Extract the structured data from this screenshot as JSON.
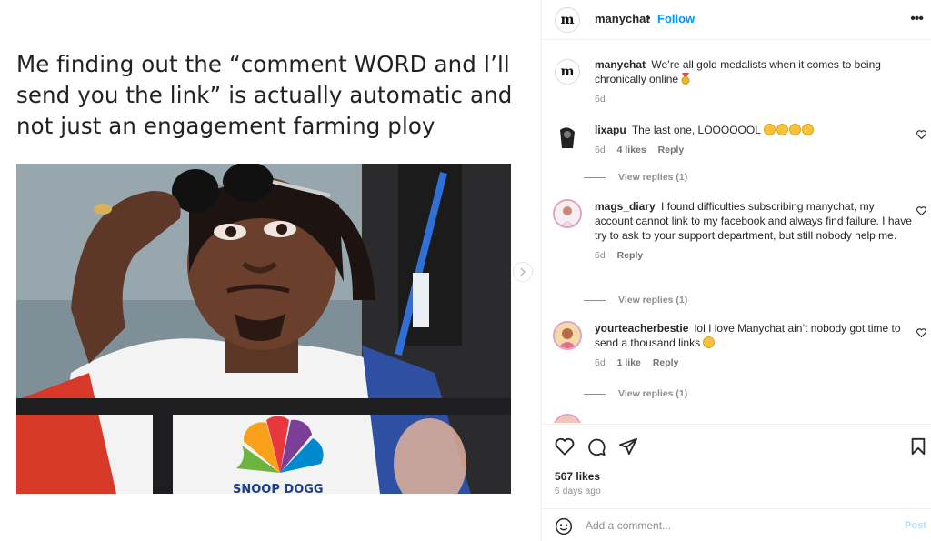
{
  "post": {
    "caption_image_text": "Me finding out the “comment WORD and I’ll send you the link” is actually automatic and not just an engagement farming ploy",
    "photo_alt": "Snoop Dogg lowering sunglasses with surprised expression",
    "photo_sign_text": "SNOOP DOGG"
  },
  "header": {
    "username": "manychat",
    "separator": "•",
    "follow_label": "Follow",
    "more_label": "•••",
    "logo_text": "m"
  },
  "owner_caption": {
    "username": "manychat",
    "text": "We’re all gold medalists when it comes to being chronically online",
    "time": "6d"
  },
  "comments": [
    {
      "username": "lixapu",
      "text": "The last one, LOOOOOOL",
      "emoji_count": 4,
      "time": "6d",
      "likes": "4 likes",
      "reply_label": "Reply",
      "view_replies": "View replies (1)"
    },
    {
      "username": "mags_diary",
      "text": "I found difficulties subscribing manychat, my account cannot link to my facebook and always find failure. I have try to ask to your support department, but still nobody help me.",
      "emoji_count": 0,
      "time": "6d",
      "likes": "",
      "reply_label": "Reply",
      "view_replies": "View replies (1)"
    },
    {
      "username": "yourteacherbestie",
      "text": "lol I love Manychat ain’t nobody got time to send a thousand links",
      "emoji_count": 1,
      "time": "6d",
      "likes": "1 like",
      "reply_label": "Reply",
      "view_replies": "View replies (1)"
    }
  ],
  "actions": {
    "likes": "567 likes",
    "time": "6 days ago"
  },
  "composer": {
    "placeholder": "Add a comment...",
    "post_label": "Post"
  },
  "colors": {
    "follow_blue": "#0095f6",
    "post_disabled": "#b2dffc",
    "muted_text": "#8e8e8e"
  },
  "icons": [
    "heart-icon",
    "comment-icon",
    "share-icon",
    "bookmark-icon",
    "emoji-icon",
    "more-icon",
    "chevron-right-icon"
  ]
}
